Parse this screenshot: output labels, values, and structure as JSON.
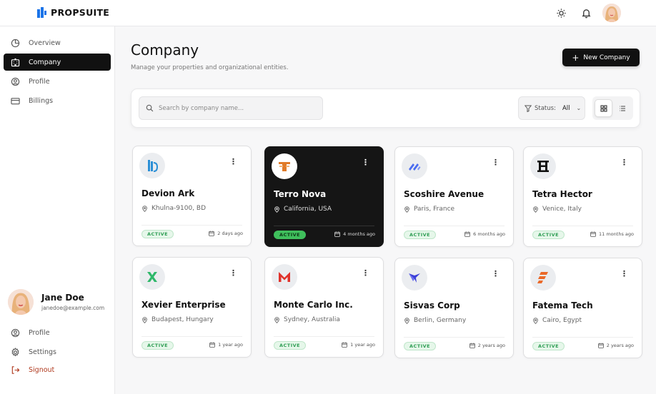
{
  "brand": {
    "name": "PROPSUITE"
  },
  "topbar": {
    "icons": [
      "sun-icon",
      "bell-icon"
    ]
  },
  "sidebar": {
    "items": [
      {
        "label": "Overview",
        "icon": "pie-chart-icon"
      },
      {
        "label": "Company",
        "icon": "building-icon",
        "active": true
      },
      {
        "label": "Profile",
        "icon": "user-circle-icon"
      },
      {
        "label": "Billings",
        "icon": "credit-card-icon"
      }
    ],
    "user": {
      "name": "Jane Doe",
      "email": "janedoe@example.com"
    },
    "bottom": [
      {
        "label": "Profile",
        "icon": "user-circle-icon"
      },
      {
        "label": "Settings",
        "icon": "gear-icon"
      },
      {
        "label": "Signout",
        "icon": "signout-icon"
      }
    ]
  },
  "header": {
    "title": "Company",
    "subtitle": "Manage your properties and organizational entities.",
    "new_button": "New Company"
  },
  "toolbar": {
    "search_placeholder": "Search by company name...",
    "status_label": "Status:",
    "status_value": "All"
  },
  "colors": {
    "accent": "#111111",
    "active_badge": "#2f9e54",
    "signout": "#b03a1e"
  },
  "companies": [
    {
      "name": "Devion Ark",
      "location": "Khulna-9100, BD",
      "status": "ACTIVE",
      "updated": "2 days ago"
    },
    {
      "name": "Terro Nova",
      "location": "California, USA",
      "status": "ACTIVE",
      "updated": "4 months ago",
      "selected": true
    },
    {
      "name": "Scoshire Avenue",
      "location": "Paris, France",
      "status": "ACTIVE",
      "updated": "6 months ago"
    },
    {
      "name": "Tetra Hector",
      "location": "Venice, Italy",
      "status": "ACTIVE",
      "updated": "11 months ago"
    },
    {
      "name": "Xevier Enterprise",
      "location": "Budapest, Hungary",
      "status": "ACTIVE",
      "updated": "1 year ago"
    },
    {
      "name": "Monte Carlo Inc.",
      "location": "Sydney, Australia",
      "status": "ACTIVE",
      "updated": "1 year ago"
    },
    {
      "name": "Sisvas Corp",
      "location": "Berlin, Germany",
      "status": "ACTIVE",
      "updated": "2 years ago"
    },
    {
      "name": "Fatema Tech",
      "location": "Cairo, Egypt",
      "status": "ACTIVE",
      "updated": "2 years ago"
    }
  ]
}
